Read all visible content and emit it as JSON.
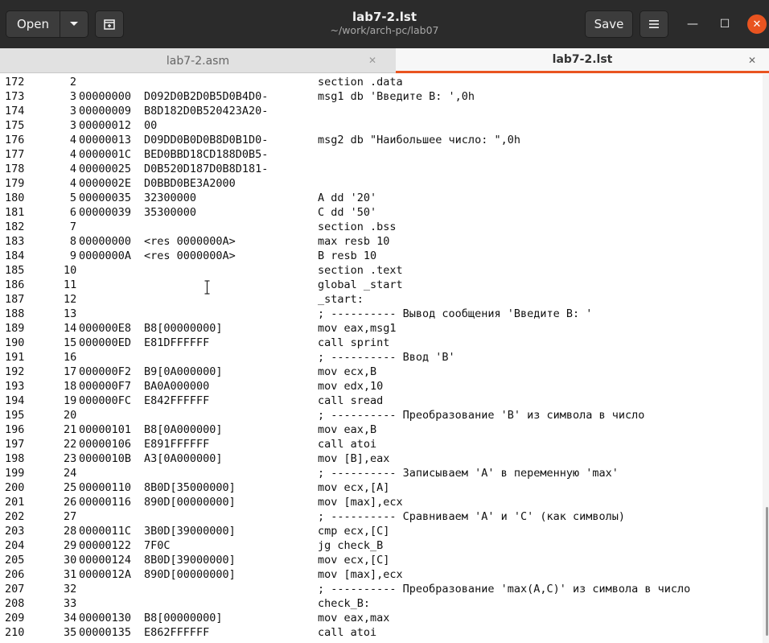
{
  "header": {
    "open_label": "Open",
    "open_menu_icon": "chevron-down-icon",
    "new_window_icon": "new-window-icon",
    "title": "lab7-2.lst",
    "subtitle": "~/work/arch-pc/lab07",
    "save_label": "Save",
    "menu_icon": "hamburger-icon",
    "minimize_glyph": "—",
    "maximize_glyph": "☐",
    "close_glyph": "✕"
  },
  "tabs": [
    {
      "label": "lab7-2.asm",
      "active": false,
      "close_glyph": "✕"
    },
    {
      "label": "lab7-2.lst",
      "active": true,
      "close_glyph": "✕"
    }
  ],
  "colors": {
    "accent": "#e95420",
    "header_bg": "#2b2b2b"
  },
  "lines": [
    {
      "ln": "172",
      "src": "2",
      "addr": "",
      "hex": "",
      "code": "section .data"
    },
    {
      "ln": "173",
      "src": "3",
      "addr": "00000000",
      "hex": "D092D0B2D0B5D0B4D0-",
      "code": "msg1 db 'Введите B: ',0h"
    },
    {
      "ln": "174",
      "src": "3",
      "addr": "00000009",
      "hex": "B8D182D0B520423A20-",
      "code": ""
    },
    {
      "ln": "175",
      "src": "3",
      "addr": "00000012",
      "hex": "00",
      "code": ""
    },
    {
      "ln": "176",
      "src": "4",
      "addr": "00000013",
      "hex": "D09DD0B0D0B8D0B1D0-",
      "code": "msg2 db \"Наибольшее число: \",0h"
    },
    {
      "ln": "177",
      "src": "4",
      "addr": "0000001C",
      "hex": "BED0BBD18CD188D0B5-",
      "code": ""
    },
    {
      "ln": "178",
      "src": "4",
      "addr": "00000025",
      "hex": "D0B520D187D0B8D181-",
      "code": ""
    },
    {
      "ln": "179",
      "src": "4",
      "addr": "0000002E",
      "hex": "D0BBD0BE3A2000",
      "code": ""
    },
    {
      "ln": "180",
      "src": "5",
      "addr": "00000035",
      "hex": "32300000",
      "code": "A dd '20'"
    },
    {
      "ln": "181",
      "src": "6",
      "addr": "00000039",
      "hex": "35300000",
      "code": "C dd '50'"
    },
    {
      "ln": "182",
      "src": "7",
      "addr": "",
      "hex": "",
      "code": "section .bss"
    },
    {
      "ln": "183",
      "src": "8",
      "addr": "00000000",
      "hex": "<res 0000000A>",
      "code": "max resb 10"
    },
    {
      "ln": "184",
      "src": "9",
      "addr": "0000000A",
      "hex": "<res 0000000A>",
      "code": "B resb 10"
    },
    {
      "ln": "185",
      "src": "10",
      "addr": "",
      "hex": "",
      "code": "section .text"
    },
    {
      "ln": "186",
      "src": "11",
      "addr": "",
      "hex": "",
      "code": "global _start"
    },
    {
      "ln": "187",
      "src": "12",
      "addr": "",
      "hex": "",
      "code": "_start:"
    },
    {
      "ln": "188",
      "src": "13",
      "addr": "",
      "hex": "",
      "code": "; ---------- Вывод сообщения 'Введите B: '"
    },
    {
      "ln": "189",
      "src": "14",
      "addr": "000000E8",
      "hex": "B8[00000000]",
      "code": "mov eax,msg1"
    },
    {
      "ln": "190",
      "src": "15",
      "addr": "000000ED",
      "hex": "E81DFFFFFF",
      "code": "call sprint"
    },
    {
      "ln": "191",
      "src": "16",
      "addr": "",
      "hex": "",
      "code": "; ---------- Ввод 'B'"
    },
    {
      "ln": "192",
      "src": "17",
      "addr": "000000F2",
      "hex": "B9[0A000000]",
      "code": "mov ecx,B"
    },
    {
      "ln": "193",
      "src": "18",
      "addr": "000000F7",
      "hex": "BA0A000000",
      "code": "mov edx,10"
    },
    {
      "ln": "194",
      "src": "19",
      "addr": "000000FC",
      "hex": "E842FFFFFF",
      "code": "call sread"
    },
    {
      "ln": "195",
      "src": "20",
      "addr": "",
      "hex": "",
      "code": "; ---------- Преобразование 'B' из символа в число"
    },
    {
      "ln": "196",
      "src": "21",
      "addr": "00000101",
      "hex": "B8[0A000000]",
      "code": "mov eax,B"
    },
    {
      "ln": "197",
      "src": "22",
      "addr": "00000106",
      "hex": "E891FFFFFF",
      "code": "call atoi"
    },
    {
      "ln": "198",
      "src": "23",
      "addr": "0000010B",
      "hex": "A3[0A000000]",
      "code": "mov [B],eax"
    },
    {
      "ln": "199",
      "src": "24",
      "addr": "",
      "hex": "",
      "code": "; ---------- Записываем 'A' в переменную 'max'"
    },
    {
      "ln": "200",
      "src": "25",
      "addr": "00000110",
      "hex": "8B0D[35000000]",
      "code": "mov ecx,[A]"
    },
    {
      "ln": "201",
      "src": "26",
      "addr": "00000116",
      "hex": "890D[00000000]",
      "code": "mov [max],ecx"
    },
    {
      "ln": "202",
      "src": "27",
      "addr": "",
      "hex": "",
      "code": "; ---------- Сравниваем 'A' и 'C' (как символы)"
    },
    {
      "ln": "203",
      "src": "28",
      "addr": "0000011C",
      "hex": "3B0D[39000000]",
      "code": "cmp ecx,[C]"
    },
    {
      "ln": "204",
      "src": "29",
      "addr": "00000122",
      "hex": "7F0C",
      "code": "jg check_B"
    },
    {
      "ln": "205",
      "src": "30",
      "addr": "00000124",
      "hex": "8B0D[39000000]",
      "code": "mov ecx,[C]"
    },
    {
      "ln": "206",
      "src": "31",
      "addr": "0000012A",
      "hex": "890D[00000000]",
      "code": "mov [max],ecx"
    },
    {
      "ln": "207",
      "src": "32",
      "addr": "",
      "hex": "",
      "code": "; ---------- Преобразование 'max(A,C)' из символа в число"
    },
    {
      "ln": "208",
      "src": "33",
      "addr": "",
      "hex": "",
      "code": "check_B:"
    },
    {
      "ln": "209",
      "src": "34",
      "addr": "00000130",
      "hex": "B8[00000000]",
      "code": "mov eax,max"
    },
    {
      "ln": "210",
      "src": "35",
      "addr": "00000135",
      "hex": "E862FFFFFF",
      "code": "call atoi"
    }
  ]
}
